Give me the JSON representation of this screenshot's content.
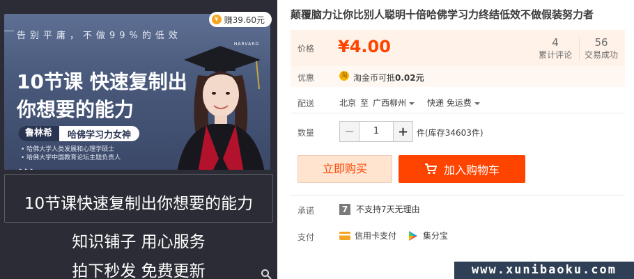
{
  "product": {
    "title": "颠覆脑力让你比别人聪明十倍哈佛学习力终结低效不做假装努力者"
  },
  "banner": {
    "slogan": "告别平庸，不做99%的低效",
    "earn_label": "赚39.60元",
    "headline_1a": "10节课",
    "headline_1b": "快速复制出",
    "headline_2": "你想要的能力",
    "teacher_name": "鲁林希",
    "teacher_title": "哈佛学习力女神",
    "bullets": [
      "• 哈佛大学人类发展和心理学硕士",
      "• 哈佛大学中国教育论坛主题负责人"
    ],
    "harvard": "HARVARD",
    "caption": "10节课快速复制出你想要的能力",
    "line_2": "知识铺子  用心服务",
    "line_3": "拍下秒发  免费更新"
  },
  "price": {
    "label": "价格",
    "value": "¥4.00",
    "reviews_count": "4",
    "reviews_label": "累计评论",
    "trades_count": "56",
    "trades_label": "交易成功"
  },
  "promo": {
    "label": "优惠",
    "coin_glyph": "淘",
    "text_pre": "淘金币可抵",
    "text_amount": "0.02元"
  },
  "shipping": {
    "label": "配送",
    "from": "北京",
    "to_word": "至",
    "destination": "广西柳州",
    "method": "快递 免运费"
  },
  "quantity": {
    "label": "数量",
    "minus": "−",
    "value": "1",
    "plus": "+",
    "stock": "件(库存34603件)"
  },
  "actions": {
    "buy_now": "立即购买",
    "add_to_cart": "加入购物车"
  },
  "service": {
    "label": "承诺",
    "icon_text": "7",
    "text": "不支持7天无理由"
  },
  "payment": {
    "label": "支付",
    "card": "信用卡支付",
    "jifenbao": "集分宝"
  },
  "watermark": "www.xunibaoku.com",
  "colors": {
    "price": "#ff4400",
    "cart_button": "#ff4400",
    "price_bg": "#fff2e8"
  }
}
